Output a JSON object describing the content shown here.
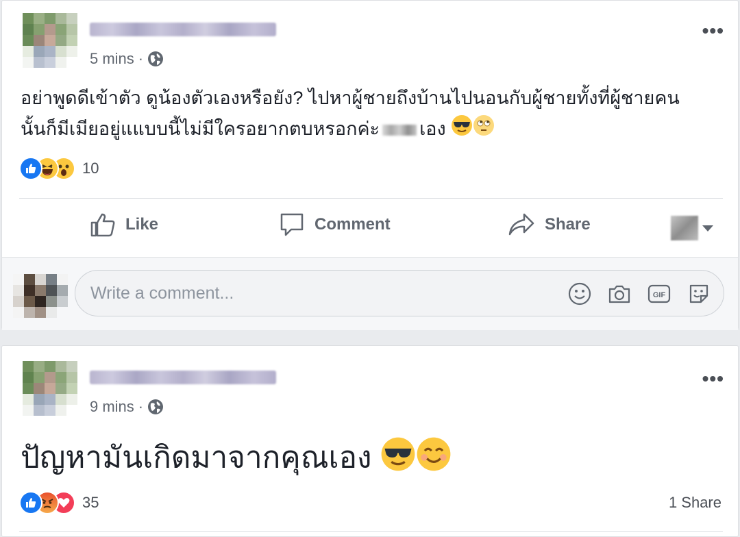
{
  "posts": [
    {
      "time": "5 mins",
      "separator": "·",
      "privacy_icon": "globe-icon",
      "more_label": "•••",
      "text_line1": "อย่าพูดดีเข้าตัว ดูน้องตัวเองหรือยัง? ไปหาผู้ชายถึงบ้านไปนอนกับผู้ชายทั้งที่ผู้ชายคน",
      "text_line2_a": "นั้นก็มีเมียอยู่แแบบนี้ไม่มีใครอยากตบหรอกค่ะ",
      "text_line2_b": "เอง",
      "emojis": [
        "smiling-face-with-sunglasses",
        "face-with-rolling-eyes"
      ],
      "reactions": [
        "like",
        "haha",
        "wow"
      ],
      "reaction_count": "10",
      "actions": {
        "like": "Like",
        "comment": "Comment",
        "share": "Share"
      },
      "comment_placeholder": "Write a comment...",
      "comment_icons": [
        "emoji-icon",
        "camera-icon",
        "gif-icon",
        "sticker-icon"
      ]
    },
    {
      "time": "9 mins",
      "separator": "·",
      "privacy_icon": "globe-icon",
      "more_label": "•••",
      "text": "ปัญหามันเกิดมาจากคุณเอง",
      "emojis": [
        "smiling-face-with-sunglasses",
        "smiling-face-with-smiling-eyes"
      ],
      "reactions": [
        "like",
        "angry",
        "love"
      ],
      "reaction_count": "35",
      "share_count": "1 Share"
    }
  ],
  "colors": {
    "like_blue": "#1877f2",
    "love_red": "#f33e58",
    "yellow": "#fcc83f",
    "angry": "#f0712c",
    "text": "#1d2129",
    "meta": "#616770"
  }
}
